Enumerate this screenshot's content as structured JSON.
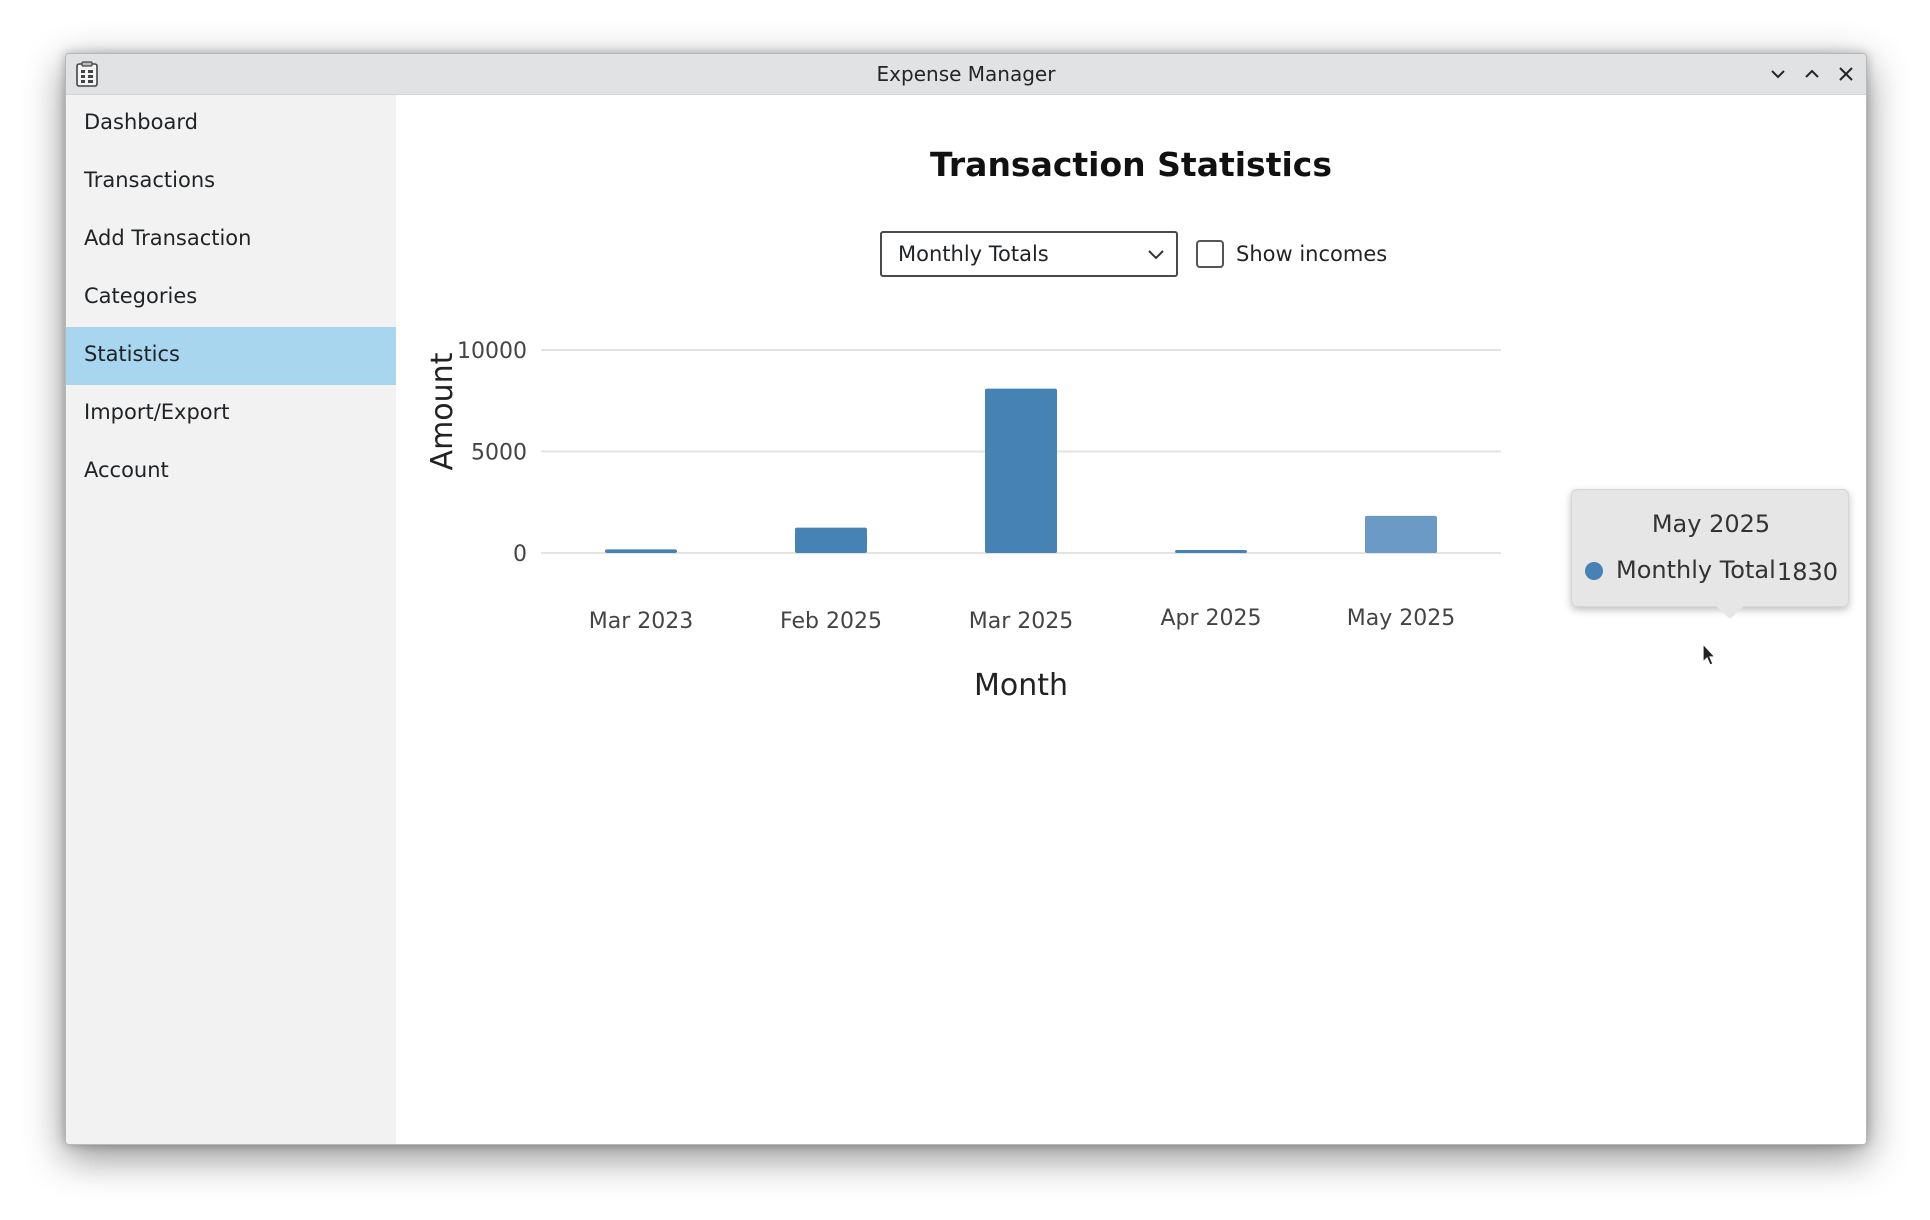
{
  "window": {
    "title": "Expense Manager"
  },
  "sidebar": {
    "items": [
      {
        "label": "Dashboard",
        "active": false
      },
      {
        "label": "Transactions",
        "active": false
      },
      {
        "label": "Add Transaction",
        "active": false
      },
      {
        "label": "Categories",
        "active": false
      },
      {
        "label": "Statistics",
        "active": true
      },
      {
        "label": "Import/Export",
        "active": false
      },
      {
        "label": "Account",
        "active": false
      }
    ]
  },
  "main": {
    "title": "Transaction Statistics",
    "view_select": {
      "selected": "Monthly Totals"
    },
    "show_incomes": {
      "label": "Show incomes",
      "checked": false
    }
  },
  "tooltip": {
    "title": "May 2025",
    "series": "Monthly Total",
    "value": "1830"
  },
  "colors": {
    "bar": "#4682b4",
    "bar_hover": "#6a9ac5",
    "active_nav": "#a8d6ee"
  },
  "chart_data": {
    "type": "bar",
    "categories": [
      "Mar 2023",
      "Feb 2025",
      "Mar 2025",
      "Apr 2025",
      "May 2025"
    ],
    "series": [
      {
        "name": "Monthly Total",
        "values": [
          180,
          1250,
          8100,
          80,
          1830
        ]
      }
    ],
    "xlabel": "Month",
    "ylabel": "Amount",
    "ylim": [
      0,
      10000
    ],
    "yticks": [
      0,
      5000,
      10000
    ],
    "grid": true,
    "highlighted_category": "May 2025"
  }
}
